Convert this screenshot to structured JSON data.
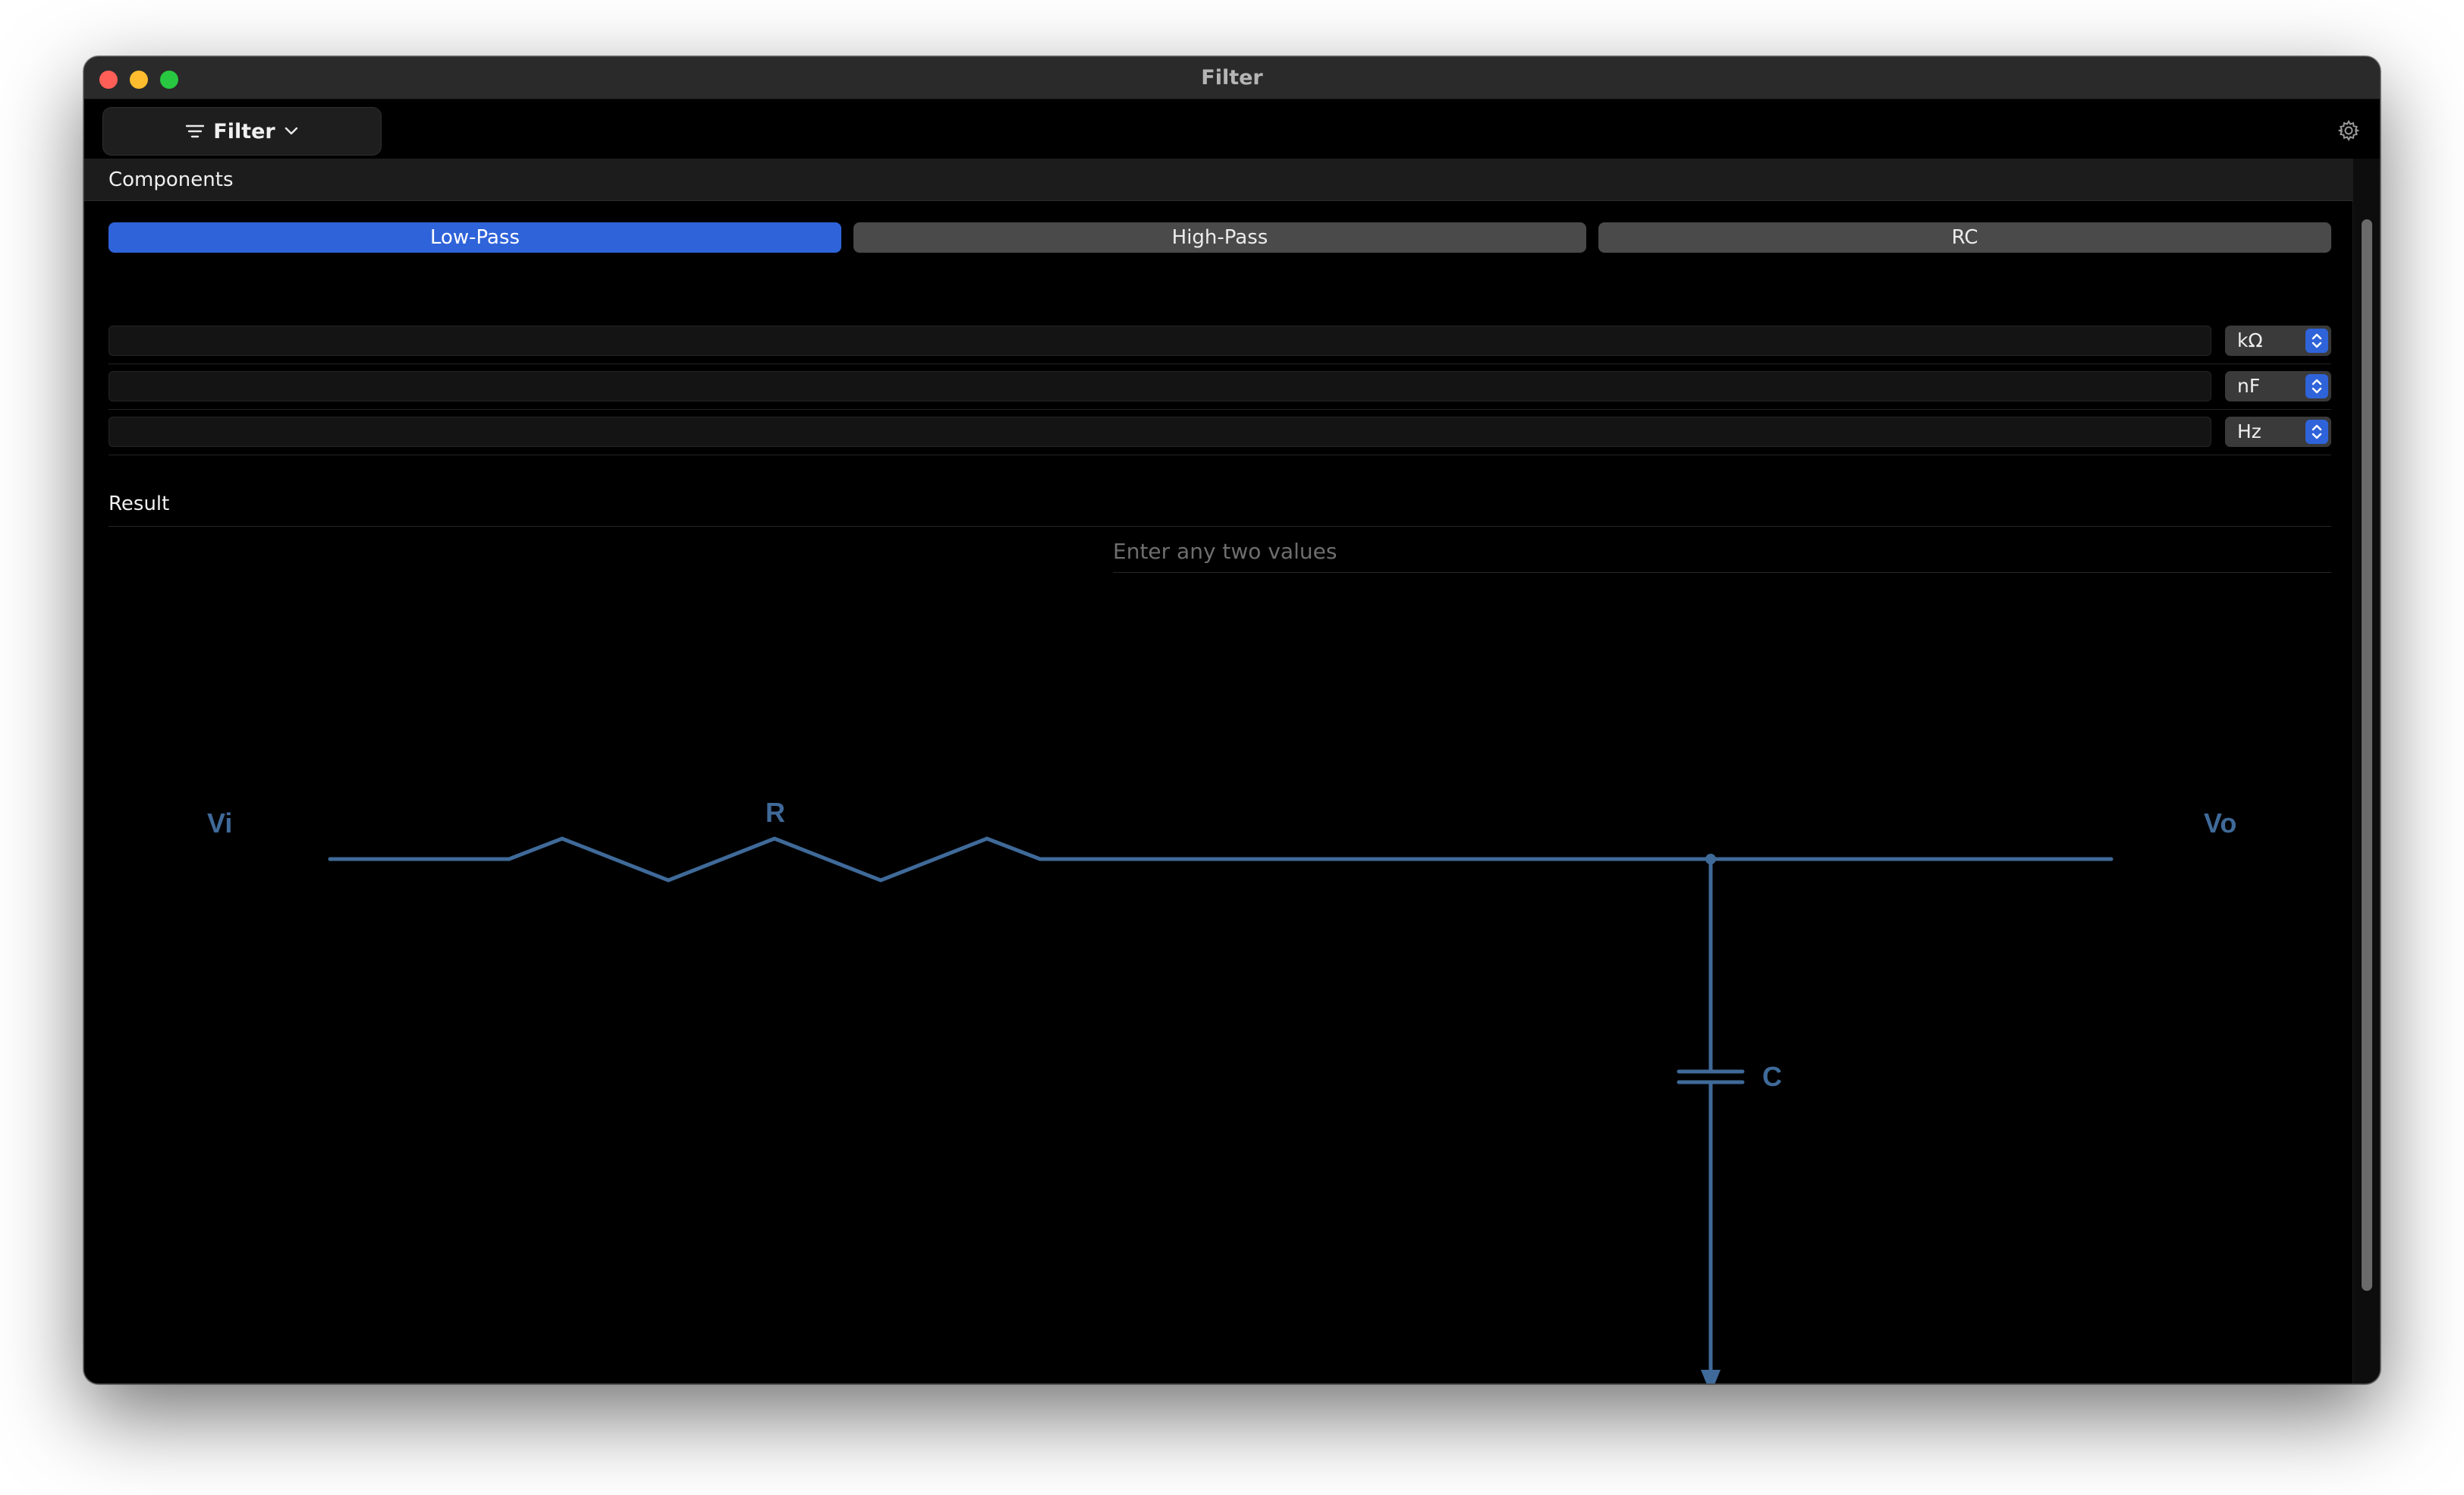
{
  "window": {
    "title": "Filter"
  },
  "toolbar": {
    "filter_label": "Filter",
    "settings_icon": "gear-icon"
  },
  "components": {
    "heading": "Components",
    "tabs": [
      {
        "label": "Low-Pass",
        "selected": true
      },
      {
        "label": "High-Pass",
        "selected": false
      },
      {
        "label": "RC",
        "selected": false
      }
    ],
    "fields": [
      {
        "value": "",
        "unit": "kΩ"
      },
      {
        "value": "",
        "unit": "nF"
      },
      {
        "value": "",
        "unit": "Hz"
      }
    ]
  },
  "result": {
    "heading": "Result",
    "placeholder": "Enter any two values"
  },
  "circuit": {
    "input_label": "Vi",
    "output_label": "Vo",
    "resistor_label": "R",
    "capacitor_label": "C",
    "color": "#3f6a99"
  },
  "colors": {
    "accent": "#2f63d9",
    "window_bg": "#000000",
    "titlebar_bg": "#2a2a2a"
  }
}
